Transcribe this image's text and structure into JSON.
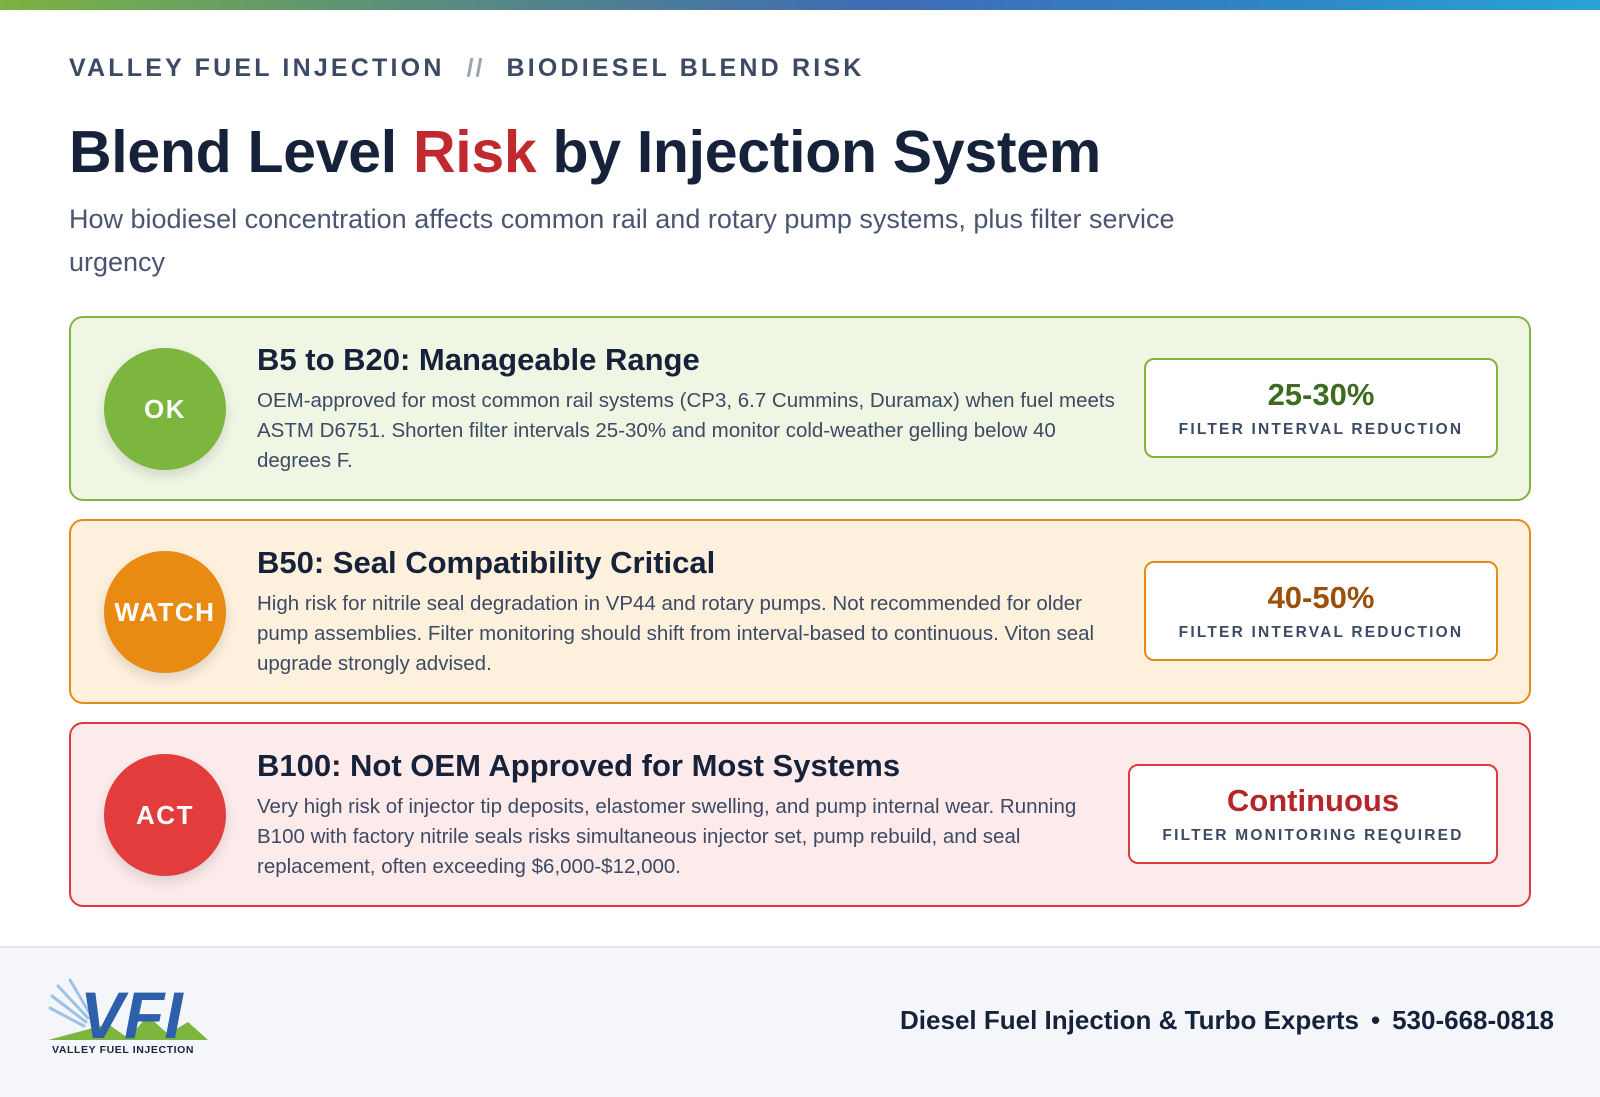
{
  "header": {
    "brand": "VALLEY FUEL INJECTION",
    "separator": "//",
    "section": "BIODIESEL BLEND RISK",
    "title_before": "Blend Level ",
    "title_accent": "Risk",
    "title_after": " by Injection System",
    "subtitle": "How biodiesel concentration affects common rail and rotary pump systems, plus filter service urgency"
  },
  "cards": [
    {
      "badge": "OK",
      "title": "B5 to B20: Manageable Range",
      "body": "OEM-approved for most common rail systems (CP3, 6.7 Cummins, Duramax) when fuel meets ASTM D6751. Shorten filter intervals 25-30% and monitor cold-weather gelling below 40 degrees F.",
      "metric_value": "25-30%",
      "metric_label": "FILTER INTERVAL REDUCTION"
    },
    {
      "badge": "WATCH",
      "title": "B50: Seal Compatibility Critical",
      "body": "High risk for nitrile seal degradation in VP44 and rotary pumps. Not recommended for older pump assemblies. Filter monitoring should shift from interval-based to continuous. Viton seal upgrade strongly advised.",
      "metric_value": "40-50%",
      "metric_label": "FILTER INTERVAL REDUCTION"
    },
    {
      "badge": "ACT",
      "title": "B100: Not OEM Approved for Most Systems",
      "body": "Very high risk of injector tip deposits, elastomer swelling, and pump internal wear. Running B100 with factory nitrile seals risks simultaneous injector set, pump rebuild, and seal replacement, often exceeding $6,000-$12,000.",
      "metric_value": "Continuous",
      "metric_label": "FILTER MONITORING REQUIRED"
    }
  ],
  "footer": {
    "logo_mark": "VFI",
    "logo_text": "VALLEY FUEL INJECTION",
    "tagline": "Diesel Fuel Injection & Turbo Experts",
    "bullet": "•",
    "phone": "530-668-0818"
  },
  "colors": {
    "ok": "#7cb63f",
    "watch": "#e98a12",
    "act": "#e23c3c",
    "accent_red": "#c0292d",
    "navy": "#16213a"
  }
}
